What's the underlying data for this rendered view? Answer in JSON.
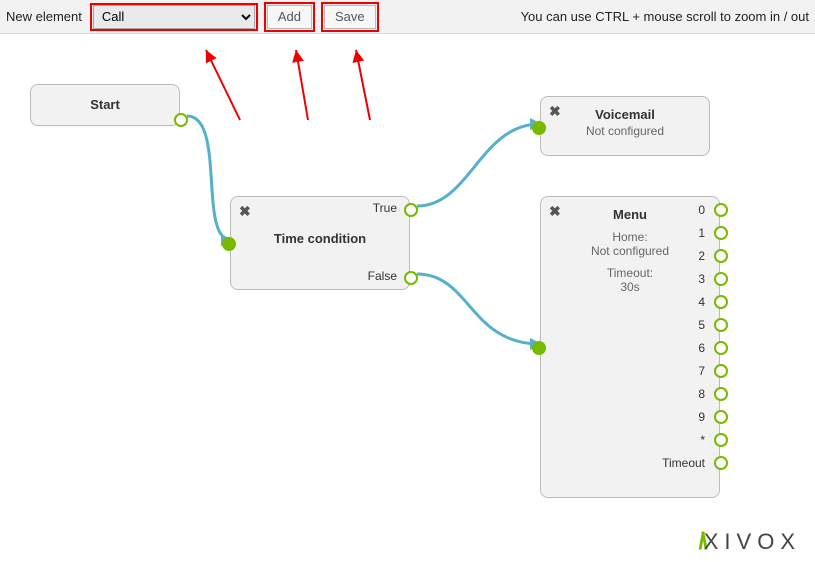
{
  "toolbar": {
    "label": "New element",
    "select_value": "Call",
    "add_label": "Add",
    "save_label": "Save",
    "hint": "You can use CTRL + mouse scroll to zoom in / out"
  },
  "nodes": {
    "start": {
      "title": "Start"
    },
    "tcond": {
      "title": "Time condition",
      "port_true": "True",
      "port_false": "False"
    },
    "vmail": {
      "title": "Voicemail",
      "status": "Not configured"
    },
    "menu": {
      "title": "Menu",
      "home_label": "Home:",
      "home_value": "Not configured",
      "timeout_label": "Timeout:",
      "timeout_value": "30s",
      "digit_ports": [
        "0",
        "1",
        "2",
        "3",
        "4",
        "5",
        "6",
        "7",
        "8",
        "9",
        "*"
      ],
      "timeout_port": "Timeout"
    }
  },
  "brand": "XIVOX"
}
